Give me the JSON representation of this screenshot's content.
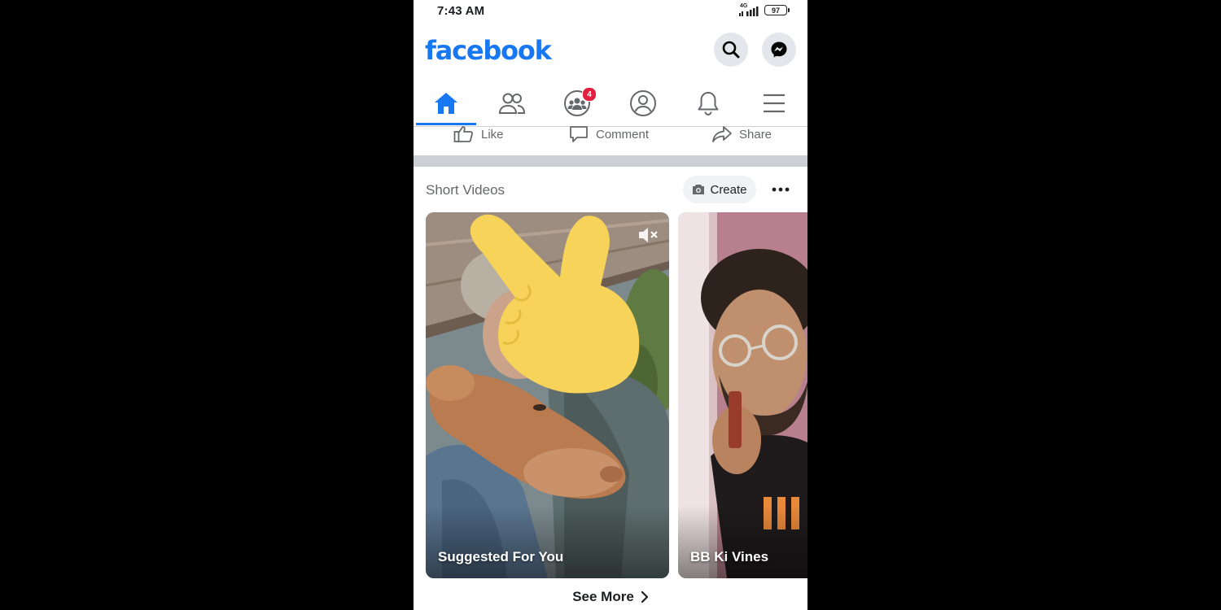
{
  "status_bar": {
    "time": "7:43 AM",
    "network": "4G",
    "battery": "97"
  },
  "header": {
    "logo": "facebook",
    "search_icon": "search-icon",
    "messenger_icon": "messenger-icon"
  },
  "tabs": [
    {
      "name": "home",
      "icon": "home-icon",
      "active": true
    },
    {
      "name": "friends",
      "icon": "friends-icon",
      "active": false
    },
    {
      "name": "groups",
      "icon": "groups-icon",
      "active": false,
      "badge": "4"
    },
    {
      "name": "profile",
      "icon": "profile-icon",
      "active": false
    },
    {
      "name": "notifications",
      "icon": "bell-icon",
      "active": false
    },
    {
      "name": "menu",
      "icon": "menu-icon",
      "active": false
    }
  ],
  "post_actions": {
    "like": "Like",
    "comment": "Comment",
    "share": "Share"
  },
  "short_videos": {
    "title": "Short Videos",
    "create": "Create",
    "cards": [
      {
        "label": "Suggested For You"
      },
      {
        "label": "BB Ki Vines"
      }
    ],
    "see_more": "See More"
  },
  "colors": {
    "brand": "#1877f2",
    "badge": "#e41e3f",
    "text_secondary": "#65676b",
    "overlay_hand": "#f7d35a"
  }
}
